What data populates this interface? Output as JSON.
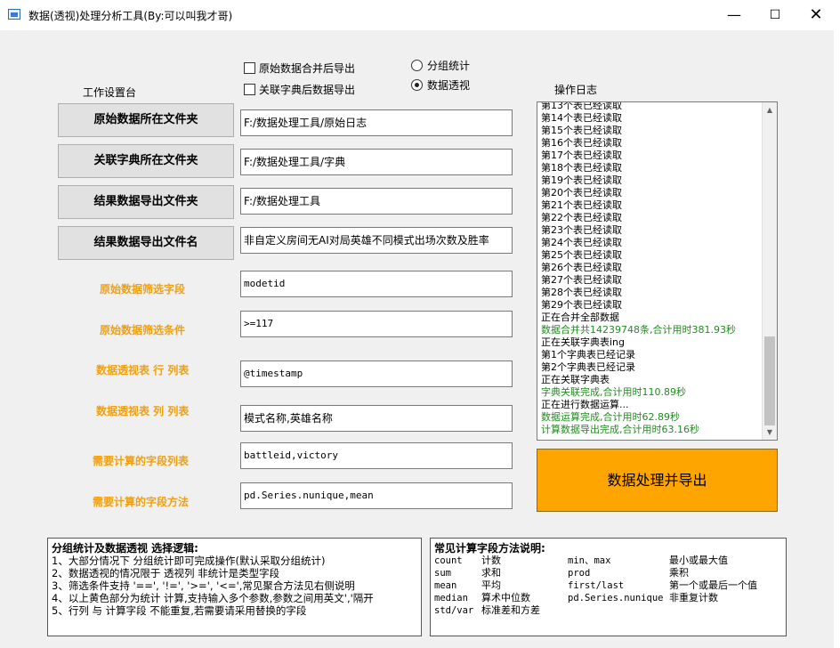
{
  "window": {
    "title": "数据(透视)处理分析工具(By:可以叫我才哥)",
    "minimize": "—",
    "maximize": "☐",
    "close": "✕"
  },
  "options": {
    "merge_export": {
      "label": "原始数据合并后导出",
      "checked": false
    },
    "dict_export": {
      "label": "关联字典后数据导出",
      "checked": false
    },
    "mode_group": {
      "label": "分组统计",
      "selected": false
    },
    "mode_pivot": {
      "label": "数据透视",
      "selected": true
    }
  },
  "workspace_label": "工作设置台",
  "log_label": "操作日志",
  "rows": [
    {
      "label": "原始数据所在文件夹",
      "value": "F:/数据处理工具/原始日志"
    },
    {
      "label": "关联字典所在文件夹",
      "value": "F:/数据处理工具/字典"
    },
    {
      "label": "结果数据导出文件夹",
      "value": "F:/数据处理工具"
    },
    {
      "label": "结果数据导出文件名",
      "value": "非自定义房间无AI对局英雄不同模式出场次数及胜率"
    }
  ],
  "fields": [
    {
      "label": "原始数据筛选字段",
      "value": "modetid"
    },
    {
      "label": "原始数据筛选条件",
      "value": ">=117"
    },
    {
      "label": "数据透视表 行 列表",
      "value": "@timestamp"
    },
    {
      "label": "数据透视表 列 列表",
      "value": "模式名称,英雄名称"
    },
    {
      "label": "需要计算的字段列表",
      "value": "battleid,victory"
    },
    {
      "label": "需要计算的字段方法",
      "value": "pd.Series.nunique,mean"
    }
  ],
  "log": [
    {
      "text": "第13个表已经读取",
      "green": false
    },
    {
      "text": "第14个表已经读取",
      "green": false
    },
    {
      "text": "第15个表已经读取",
      "green": false
    },
    {
      "text": "第16个表已经读取",
      "green": false
    },
    {
      "text": "第17个表已经读取",
      "green": false
    },
    {
      "text": "第18个表已经读取",
      "green": false
    },
    {
      "text": "第19个表已经读取",
      "green": false
    },
    {
      "text": "第20个表已经读取",
      "green": false
    },
    {
      "text": "第21个表已经读取",
      "green": false
    },
    {
      "text": "第22个表已经读取",
      "green": false
    },
    {
      "text": "第23个表已经读取",
      "green": false
    },
    {
      "text": "第24个表已经读取",
      "green": false
    },
    {
      "text": "第25个表已经读取",
      "green": false
    },
    {
      "text": "第26个表已经读取",
      "green": false
    },
    {
      "text": "第27个表已经读取",
      "green": false
    },
    {
      "text": "第28个表已经读取",
      "green": false
    },
    {
      "text": "第29个表已经读取",
      "green": false
    },
    {
      "text": "正在合并全部数据",
      "green": false
    },
    {
      "text": "数据合并共14239748条,合计用时381.93秒",
      "green": true
    },
    {
      "text": "正在关联字典表ing",
      "green": false
    },
    {
      "text": "第1个字典表已经记录",
      "green": false
    },
    {
      "text": "第2个字典表已经记录",
      "green": false
    },
    {
      "text": "正在关联字典表",
      "green": false
    },
    {
      "text": "字典关联完成,合计用时110.89秒",
      "green": true
    },
    {
      "text": "正在进行数据运算...",
      "green": false
    },
    {
      "text": "数据运算完成,合计用时62.89秒",
      "green": true
    },
    {
      "text": "计算数据导出完成,合计用时63.16秒",
      "green": true
    }
  ],
  "run_button": "数据处理并导出",
  "logic_panel": {
    "title": "分组统计及数据透视 选择逻辑:",
    "lines": [
      "1、大部分情况下 分组统计即可完成操作(默认采取分组统计)",
      "2、数据透视的情况限于 透视列 非统计是类型字段",
      "3、筛选条件支持 '==', '!=', '>=', '<=',常见聚合方法见右侧说明",
      "4、以上黄色部分为统计 计算,支持输入多个参数,参数之间用英文','隔开",
      "5、行列 与 计算字段 不能重复,若需要请采用替换的字段"
    ]
  },
  "methods_panel": {
    "title": "常见计算字段方法说明:",
    "left": [
      {
        "name": "count",
        "desc": "计数"
      },
      {
        "name": "sum",
        "desc": "求和"
      },
      {
        "name": "mean",
        "desc": "平均"
      },
      {
        "name": "median",
        "desc": "算术中位数"
      },
      {
        "name": "std/var",
        "desc": "标准差和方差"
      }
    ],
    "right": [
      {
        "name": "min、max",
        "desc": "最小或最大值"
      },
      {
        "name": "prod",
        "desc": "乘积"
      },
      {
        "name": "first/last",
        "desc": "第一个或最后一个值"
      },
      {
        "name": "pd.Series.nunique",
        "desc": "非重复计数"
      }
    ]
  }
}
